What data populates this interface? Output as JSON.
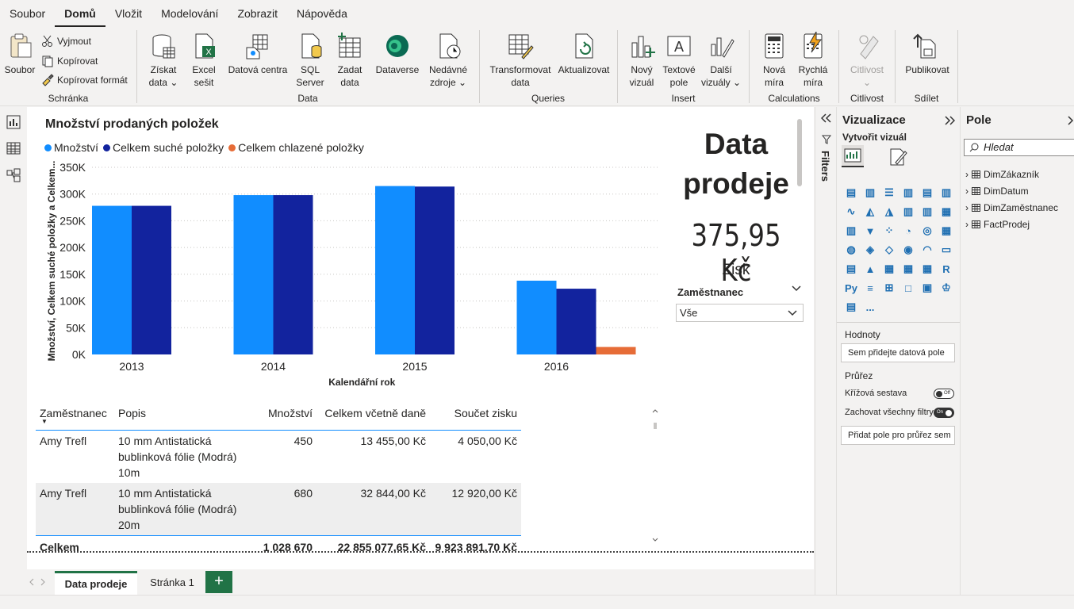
{
  "menu": {
    "items": [
      "Soubor",
      "Domů",
      "Vložit",
      "Modelování",
      "Zobrazit",
      "Nápověda"
    ],
    "active": "Domů"
  },
  "ribbon": {
    "clipboard": {
      "paste": "Soubor",
      "cut": "Vyjmout",
      "copy": "Kopírovat",
      "format": "Kopírovat formát",
      "group": "Schránka"
    },
    "data": {
      "get1": "Získat",
      "get2": "data ⌄",
      "excel1": "Excel",
      "excel2": "sešit",
      "dc": "Datová centra",
      "sql1": "SQL",
      "sql2": "Server",
      "enter1": "Zadat",
      "enter2": "data",
      "dv": "Dataverse",
      "recent1": "Nedávné",
      "recent2": "zdroje ⌄",
      "group": "Data"
    },
    "queries": {
      "transform1": "Transformovat",
      "transform2": "data",
      "refresh": "Aktualizovat",
      "group": "Queries"
    },
    "insert": {
      "nv1": "Nový",
      "nv2": "vizuál",
      "tb1": "Textové",
      "tb2": "pole",
      "mv1": "Další",
      "mv2": "vizuály ⌄",
      "group": "Insert"
    },
    "calc": {
      "nm1": "Nová",
      "nm2": "míra",
      "qm1": "Rychlá",
      "qm2": "míra",
      "group": "Calculations"
    },
    "sens": {
      "label": "Citlivost",
      "caret": "⌄",
      "group": "Citlivost"
    },
    "share": {
      "publish": "Publikovat",
      "group": "Sdílet"
    }
  },
  "chart": {
    "title": "Množství prodaných položek",
    "xlabel": "Kalendářní rok",
    "ylabel": "Množství, Celkem suché položky a Celkem..."
  },
  "chart_data": {
    "type": "bar",
    "title": "Množství prodaných položek",
    "xlabel": "Kalendářní rok",
    "ylabel": "Množství, Celkem suché položky a Celkem...",
    "categories": [
      "2013",
      "2014",
      "2015",
      "2016"
    ],
    "series": [
      {
        "name": "Množství",
        "color": "#118dff",
        "values": [
          278000,
          298000,
          315000,
          138000
        ]
      },
      {
        "name": "Celkem suché položky",
        "color": "#12239e",
        "values": [
          278000,
          298000,
          314000,
          123000
        ]
      },
      {
        "name": "Celkem chlazené položky",
        "color": "#e66c37",
        "values": [
          0,
          0,
          0,
          14000
        ]
      }
    ],
    "ylim": [
      0,
      350000
    ],
    "yticks": [
      "0K",
      "50K",
      "100K",
      "150K",
      "200K",
      "250K",
      "300K",
      "350K"
    ],
    "grid": true,
    "legend": "top-left"
  },
  "card": {
    "title": "Data prodeje",
    "value": "375,95 Kč",
    "label": "Zisk"
  },
  "slicer": {
    "title": "Zaměstnanec",
    "value": "Vše"
  },
  "table": {
    "headers": [
      "Zaměstnanec",
      "Popis",
      "Množství",
      "Celkem včetně daně",
      "Součet zisku"
    ],
    "rows": [
      [
        "Amy Trefl",
        "10 mm Antistatická bublinková fólie (Modrá) 10m",
        "450",
        "13 455,00 Kč",
        "4 050,00 Kč"
      ],
      [
        "Amy Trefl",
        "10 mm Antistatická bublinková fólie (Modrá) 20m",
        "680",
        "32 844,00 Kč",
        "12 920,00 Kč"
      ]
    ],
    "total": [
      "Celkem",
      "",
      "1 028 670",
      "22 855 077,65 Kč",
      "9 923 891,70 Kč"
    ]
  },
  "filters": {
    "label": "Filters"
  },
  "viz": {
    "title": "Vizualizace",
    "build": "Vytvořit vizuál",
    "values": "Hodnoty",
    "values_ph": "Sem přidejte datová pole",
    "drill": "Průřez",
    "cross": "Křížová sestava",
    "cross_state": "Off",
    "keep": "Zachovat všechny filtry",
    "keep_state": "On",
    "drill_ph": "Přidat pole pro průřez sem",
    "r": "R",
    "py": "Py",
    "more": "..."
  },
  "fields": {
    "title": "Pole",
    "search_ph": "Hledat",
    "tables": [
      "DimZákazník",
      "DimDatum",
      "DimZaměstnanec",
      "FactProdej"
    ]
  },
  "pages": {
    "tabs": [
      "Data prodeje",
      "Stránka 1"
    ],
    "add": "+"
  }
}
